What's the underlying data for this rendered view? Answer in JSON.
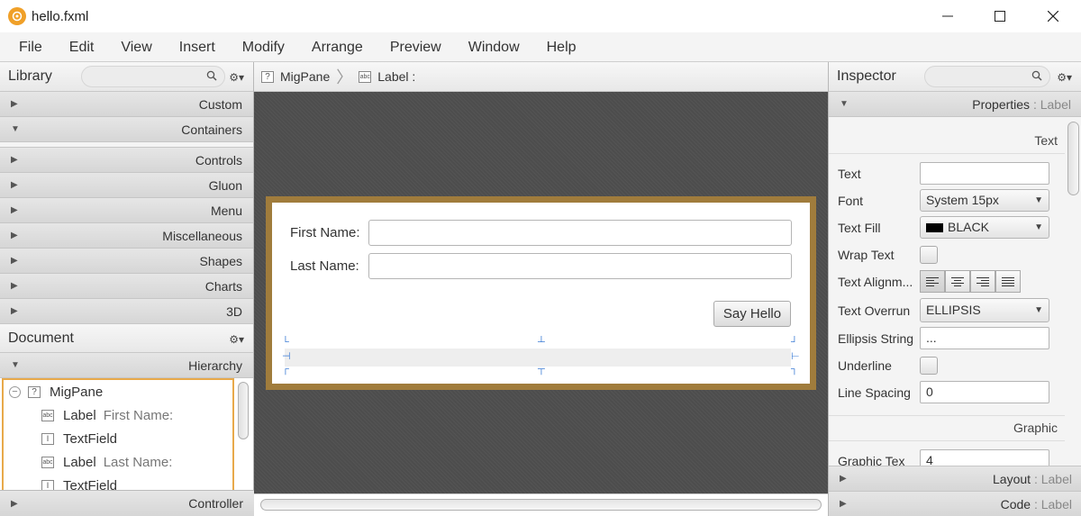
{
  "window": {
    "title": "hello.fxml"
  },
  "menubar": [
    "File",
    "Edit",
    "View",
    "Insert",
    "Modify",
    "Arrange",
    "Preview",
    "Window",
    "Help"
  ],
  "library": {
    "title": "Library",
    "sections": [
      "Custom",
      "Containers",
      "Controls",
      "Gluon",
      "Menu",
      "Miscellaneous",
      "Shapes",
      "Charts",
      "3D"
    ]
  },
  "document": {
    "title": "Document",
    "hierarchy_label": "Hierarchy",
    "tree": [
      {
        "type": "MigPane",
        "sub": ""
      },
      {
        "type": "Label",
        "sub": "First Name:"
      },
      {
        "type": "TextField",
        "sub": ""
      },
      {
        "type": "Label",
        "sub": "Last Name:"
      },
      {
        "type": "TextField",
        "sub": ""
      }
    ],
    "controller_label": "Controller"
  },
  "breadcrumb": {
    "root": "MigPane",
    "leaf": "Label :"
  },
  "form": {
    "first_name_label": "First Name:",
    "last_name_label": "Last Name:",
    "button_label": "Say Hello"
  },
  "inspector": {
    "title": "Inspector",
    "properties_label": "Properties",
    "properties_target": " : Label",
    "text_section": "Text",
    "graphic_section": "Graphic",
    "props": {
      "text_label": "Text",
      "text_value": "",
      "font_label": "Font",
      "font_value": "System 15px",
      "fill_label": "Text Fill",
      "fill_value": "BLACK",
      "wrap_label": "Wrap Text",
      "align_label": "Text Alignm...",
      "overrun_label": "Text Overrun",
      "overrun_value": "ELLIPSIS",
      "ellipsis_label": "Ellipsis String",
      "ellipsis_value": "...",
      "underline_label": "Underline",
      "spacing_label": "Line Spacing",
      "spacing_value": "0",
      "graphic_label": "Graphic Tex",
      "graphic_value": "4"
    },
    "layout_label": "Layout",
    "layout_target": " : Label",
    "code_label": "Code",
    "code_target": " : Label"
  },
  "colors": {
    "frame": "#a07c3c",
    "accent_orange": "#f0a028",
    "selection": "#e8a94a"
  }
}
